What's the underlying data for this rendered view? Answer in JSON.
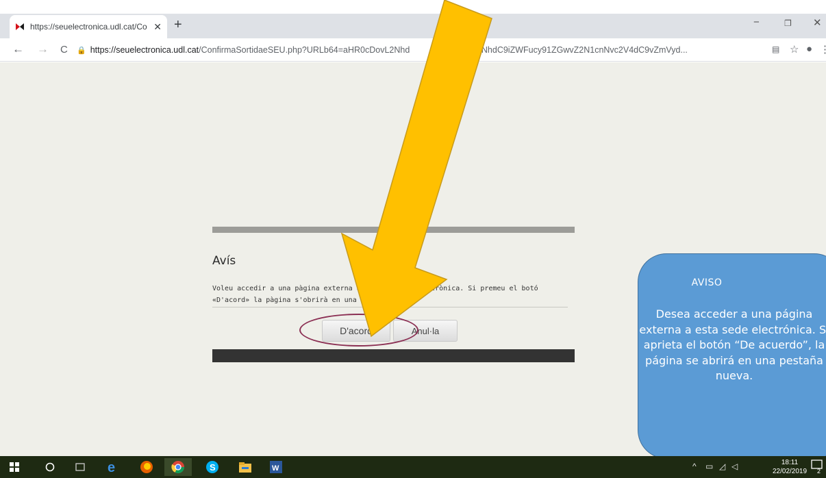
{
  "browser": {
    "tab_title": "https://seuelectronica.udl.cat/Co",
    "url_host": "https://seuelectronica.udl.cat",
    "url_path": "/ConfirmaSortidaeSEU.php?URLb64=aHR0cDovL2Nhd",
    "url_tail": "xudWRsLmNhdC9iZWFucy91ZGwvZ2N1cnNvc2V4dC9vZmVyd...",
    "new_tab": "+",
    "close_tab": "✕",
    "minimize": "−",
    "restore": "❐",
    "close_window": "✕"
  },
  "page": {
    "title": "Avís",
    "message": "Voleu accedir a una pàgina externa a aquesta seu electrònica. Si premeu el botó «D'acord» la pàgina s'obrirà en una pestanya nova.",
    "accept_label": "D'acord",
    "cancel_label": "Anul·la"
  },
  "callout": {
    "heading": "AVISO",
    "body": "Desea acceder a una página externa a esta sede electrónica. Si aprieta el botón “De acuerdo”, la página se abrirá en una pestaña nueva."
  },
  "taskbar": {
    "time": "18:11",
    "date": "22/02/2019",
    "notifications": "2"
  },
  "colors": {
    "page_background": "#efefe9",
    "arrow_fill": "#ffc000",
    "callout_fill": "#5b9bd5",
    "highlight_ring": "#8b2f53",
    "taskbar": "#1e2a12"
  }
}
